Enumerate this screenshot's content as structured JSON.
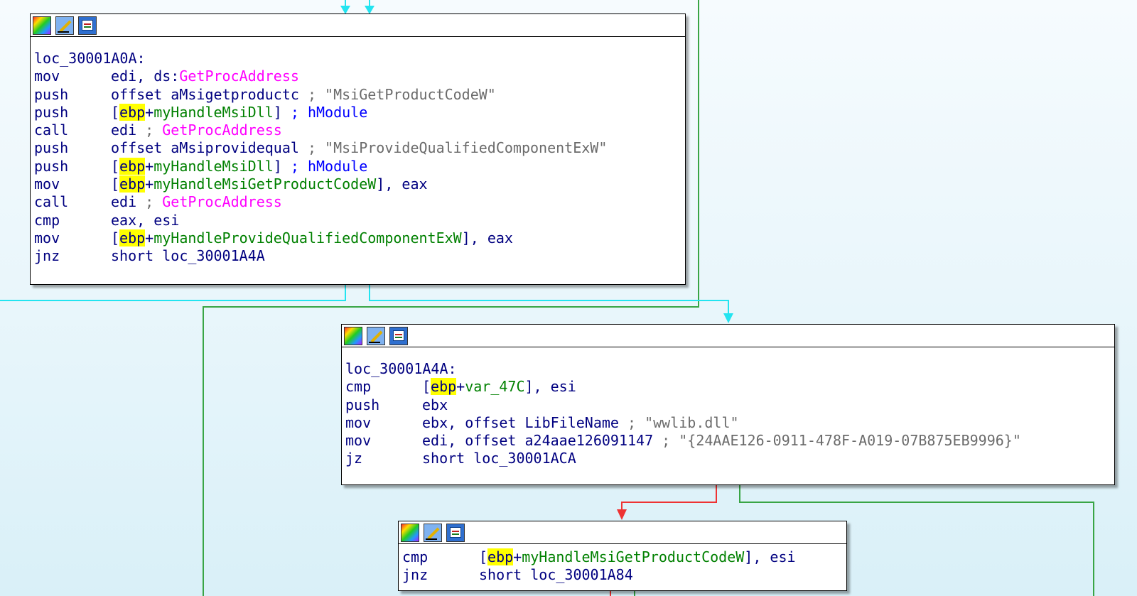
{
  "colors": {
    "edge_cyan": "#23e4f0",
    "edge_green": "#39a545",
    "edge_red": "#ee3333",
    "mnemonic": "#000080",
    "function": "#ff00ff",
    "variable": "#008000",
    "comment": "#6b6b6b",
    "highlight": "#ffff00"
  },
  "header_icons": [
    "palette-icon",
    "pencil-icon",
    "graph-icon"
  ],
  "block1": {
    "label": "loc_30001A0A:",
    "l1": {
      "mn": "mov",
      "a": "edi, ds:",
      "fn": "GetProcAddress"
    },
    "l2": {
      "mn": "push",
      "a": "offset aMsigetproductc",
      "c": " ; \"MsiGetProductCodeW\""
    },
    "l3": {
      "mn": "push",
      "br": "[",
      "reg": "ebp",
      "plus": "+",
      "var": "myHandleMsiDll",
      "cb": "]",
      "c": " ; hModule"
    },
    "l4": {
      "mn": "call",
      "a": "edi",
      "c": " ; ",
      "fn": "GetProcAddress"
    },
    "l5": {
      "mn": "push",
      "a": "offset aMsiprovidequal",
      "c": " ; \"MsiProvideQualifiedComponentExW\""
    },
    "l6": {
      "mn": "push",
      "br": "[",
      "reg": "ebp",
      "plus": "+",
      "var": "myHandleMsiDll",
      "cb": "]",
      "c": " ; hModule"
    },
    "l7": {
      "mn": "mov",
      "br": "[",
      "reg": "ebp",
      "plus": "+",
      "var": "myHandleMsiGetProductCodeW",
      "cb": "], eax"
    },
    "l8": {
      "mn": "call",
      "a": "edi",
      "c": " ; ",
      "fn": "GetProcAddress"
    },
    "l9": {
      "mn": "cmp",
      "a": "eax, esi"
    },
    "l10": {
      "mn": "mov",
      "br": "[",
      "reg": "ebp",
      "plus": "+",
      "var": "myHandleProvideQualifiedComponentExW",
      "cb": "], eax"
    },
    "l11": {
      "mn": "jnz",
      "a": "short loc_30001A4A"
    }
  },
  "block2": {
    "label": "loc_30001A4A:",
    "l1": {
      "mn": "cmp",
      "br": "[",
      "reg": "ebp",
      "plus": "+",
      "var": "var_47C",
      "cb": "], esi"
    },
    "l2": {
      "mn": "push",
      "a": "ebx"
    },
    "l3": {
      "mn": "mov",
      "a": "ebx, offset LibFileName",
      "c": " ; \"wwlib.dll\""
    },
    "l4": {
      "mn": "mov",
      "a": "edi, offset a24aae126091147",
      "c": " ; \"{24AAE126-0911-478F-A019-07B875EB9996}\""
    },
    "l5": {
      "mn": "jz",
      "a": "short loc_30001ACA"
    }
  },
  "block3": {
    "l1": {
      "mn": "cmp",
      "br": "[",
      "reg": "ebp",
      "plus": "+",
      "var": "myHandleMsiGetProductCodeW",
      "cb": "], esi"
    },
    "l2": {
      "mn": "jnz",
      "a": "short loc_30001A84"
    }
  }
}
